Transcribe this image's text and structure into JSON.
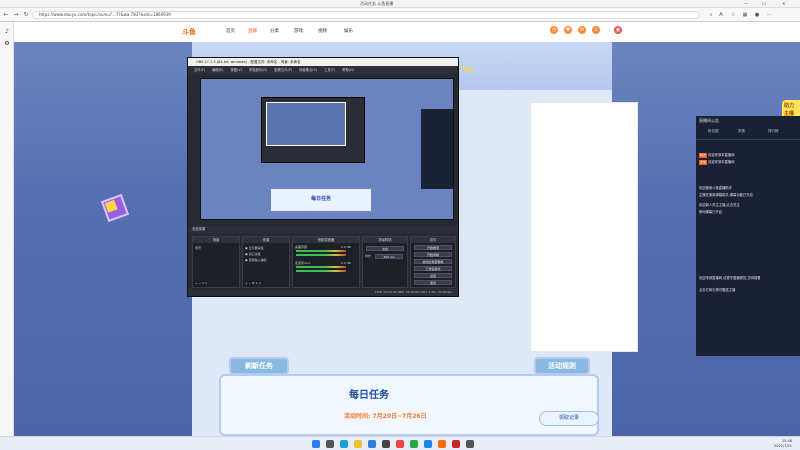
{
  "browser": {
    "title": "活动任务 斗鱼直播",
    "url": "https://www.douyu.com/topic/sumu?...7?&wa:783?&vid=1860939",
    "win_min": "—",
    "win_max": "☐",
    "win_close": "✕"
  },
  "site": {
    "logo": "斗鱼",
    "nav": [
      "首页",
      "直播",
      "分类",
      "游戏",
      "视频",
      "娱乐"
    ],
    "banner_text": "DOUYU"
  },
  "obs": {
    "title": "OBS 27.1.3 (64-bit, windows) - 配置文件: 未命名 - 场景: 未命名",
    "menu": [
      "文件(F)",
      "编辑(E)",
      "视图(V)",
      "停靠部件(D)",
      "配置文件(P)",
      "场景集合(S)",
      "工具(T)",
      "帮助(H)"
    ],
    "preview_task": "每日任务",
    "scene_bar": "未选择源",
    "docks": {
      "scenes": "场景",
      "scene_item": "场景",
      "sources": "来源",
      "source_items": [
        "显示器采集",
        "窗口采集",
        "音频输入捕获"
      ],
      "mixer": "音频混音器",
      "mixer_items": [
        "桌面音频",
        "麦克风/Aux"
      ],
      "mixer_levels": [
        "0.0 dB",
        "0.0 dB"
      ],
      "transitions": "场景转场",
      "transition_value": "淡出",
      "duration_label": "时长",
      "duration_value": "300 ms",
      "controls": "控件",
      "buttons": [
        "开始推流",
        "开始录制",
        "启动虚拟摄像机",
        "工作室模式",
        "设置",
        "退出"
      ]
    },
    "status": "LIVE: 00:00:00   REC: 00:00:00   CPU: 2.4%, 30.00 fps"
  },
  "chat": {
    "header": "直播间公告",
    "tabs": [
      "粉丝团",
      "贵族",
      "排行榜"
    ],
    "messages": [
      "欢迎来到本直播间",
      "欢迎来到本直播间",
      "欢迎使用斗鱼直播助手",
      "主播在使用弹幕助手,弹幕功能已开启",
      "欢迎新人关注主播,点击关注",
      "房间弹幕已开启",
      "",
      "欢迎来到直播间,请遵守直播规范,文明观看",
      "点击右侧礼物可赠送主播"
    ],
    "badges": [
      "粉丝",
      "贵族"
    ]
  },
  "event": {
    "tab_left": "刷新任务",
    "tab_right": "活动规则",
    "title": "每日任务",
    "time": "活动时间: 7月20日~7月26日",
    "claim_button": "领取记录"
  },
  "taskbar": {
    "time": "15:48",
    "date": "2022/7/21"
  }
}
